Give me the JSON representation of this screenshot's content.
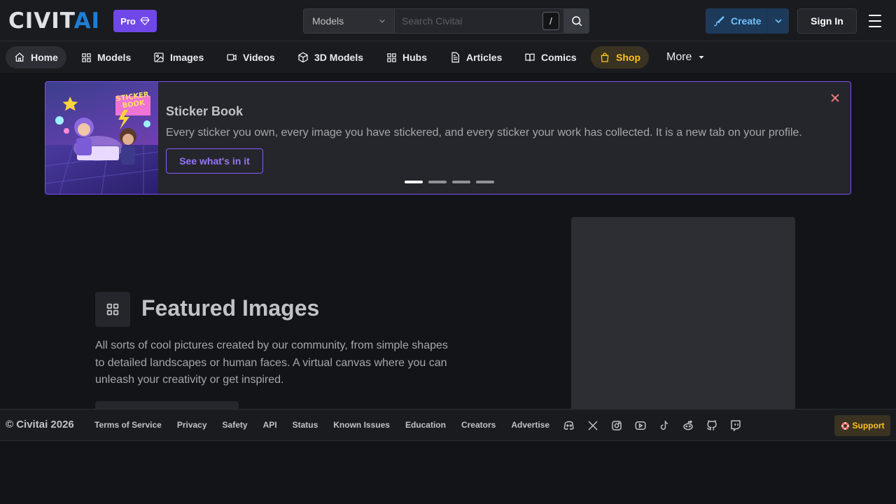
{
  "header": {
    "logo": {
      "part1": "CIVIT",
      "part2": "AI"
    },
    "pro_label": "Pro",
    "search": {
      "scope": "Models",
      "placeholder": "Search Civitai",
      "shortcut": "/"
    },
    "create_label": "Create",
    "signin_label": "Sign In"
  },
  "nav": {
    "items": [
      {
        "label": "Home",
        "icon": "home-icon",
        "active": true
      },
      {
        "label": "Models",
        "icon": "grid-icon"
      },
      {
        "label": "Images",
        "icon": "image-icon"
      },
      {
        "label": "Videos",
        "icon": "video-icon"
      },
      {
        "label": "3D Models",
        "icon": "cube-icon"
      },
      {
        "label": "Hubs",
        "icon": "grid-icon"
      },
      {
        "label": "Articles",
        "icon": "file-icon"
      },
      {
        "label": "Comics",
        "icon": "book-icon"
      },
      {
        "label": "Shop",
        "icon": "shopping-bag-icon",
        "highlight": true
      }
    ],
    "more_label": "More"
  },
  "banner": {
    "image_text": "STICKER BOOK",
    "title": "Sticker Book",
    "description": "Every sticker you own, every image you have stickered, and every sticker your work has collected. It is a new tab on your profile.",
    "cta_label": "See what's in it",
    "slide_count": 4,
    "active_slide": 1
  },
  "featured": {
    "title": "Featured Images",
    "description": "All sorts of cool pictures created by our community, from simple shapes to detailed landscapes or human faces. A virtual canvas where you can unleash your creativity or get inspired."
  },
  "footer": {
    "copyright": "© Civitai 2026",
    "links": [
      "Terms of Service",
      "Privacy",
      "Safety",
      "API",
      "Status",
      "Known Issues",
      "Education",
      "Creators",
      "Advertise"
    ],
    "socials": [
      "discord-icon",
      "x-icon",
      "instagram-icon",
      "youtube-icon",
      "tiktok-icon",
      "reddit-icon",
      "github-icon",
      "twitch-icon"
    ],
    "support_label": "Support"
  },
  "colors": {
    "background": "#131418",
    "header": "#1a1b1e",
    "accent_violet": "#7950f2",
    "accent_blue": "#74c0fc",
    "shop_yellow": "#fcc419"
  }
}
